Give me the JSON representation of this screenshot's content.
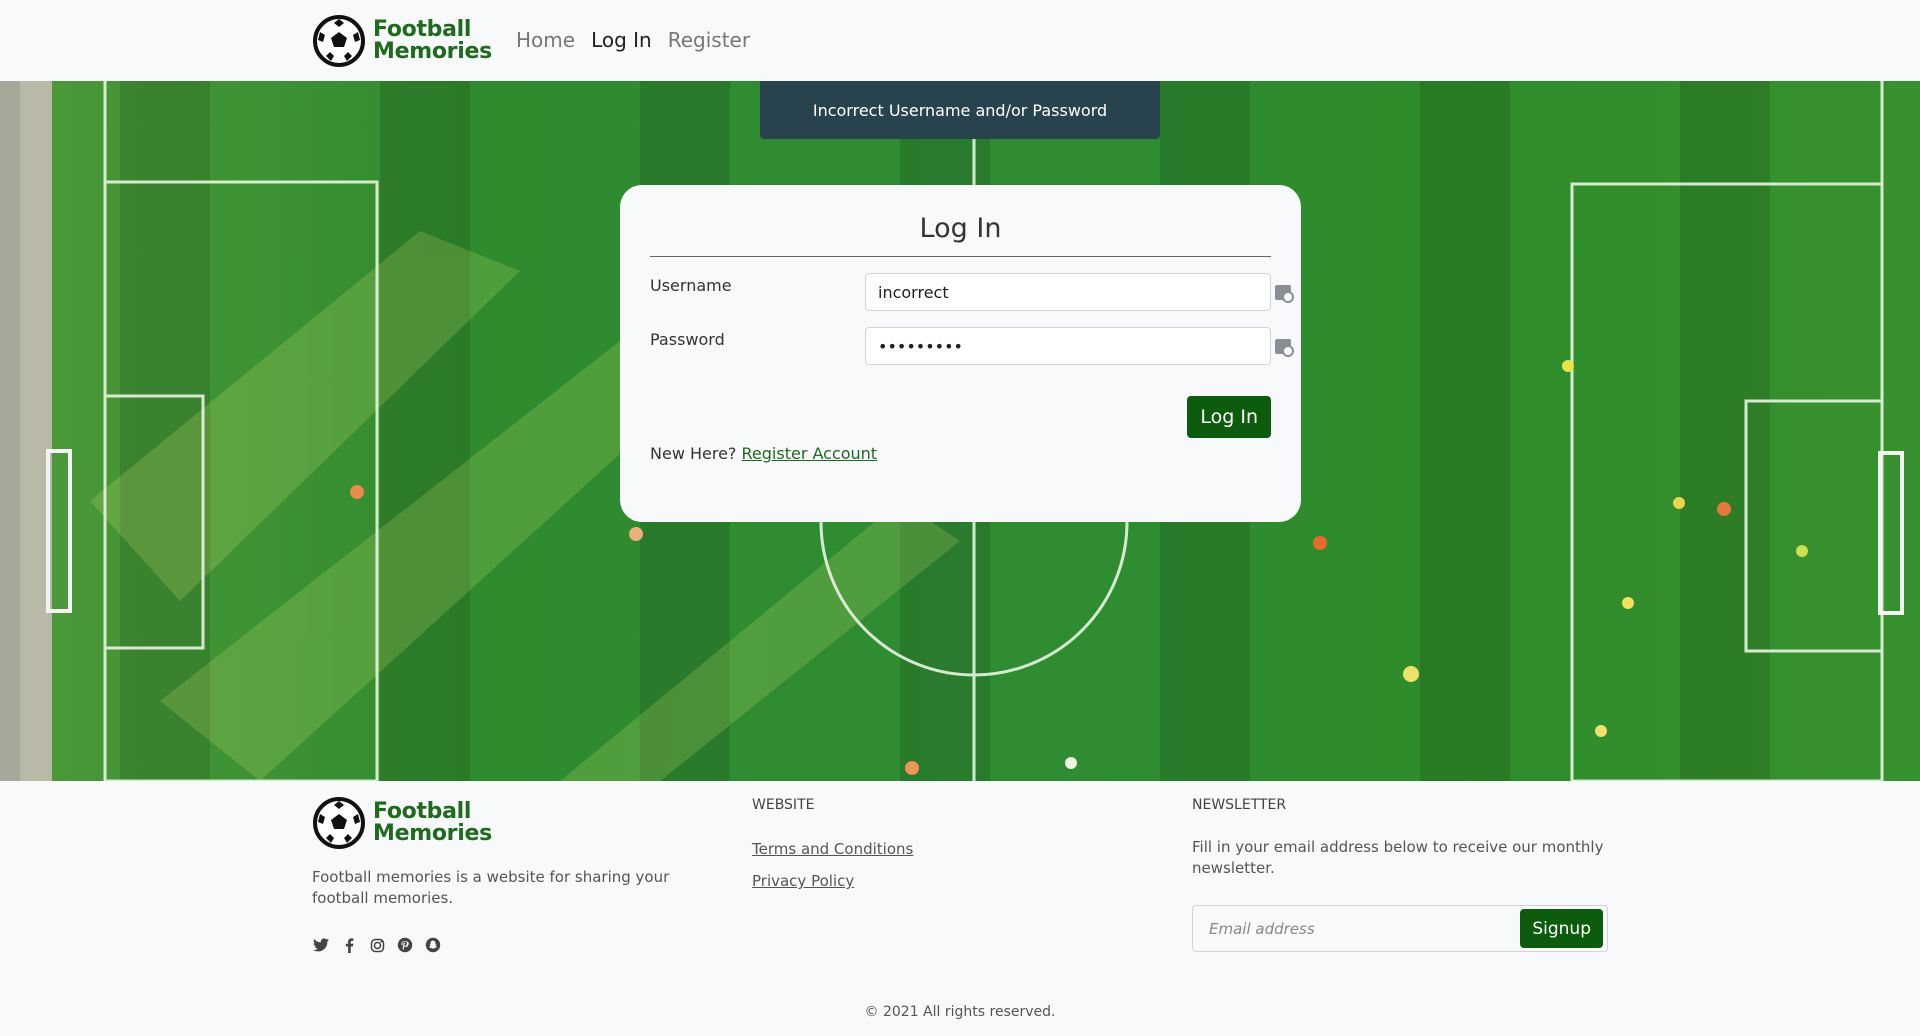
{
  "navbar": {
    "brand_line1": "Football",
    "brand_line2": "Memories",
    "links": [
      {
        "label": "Home",
        "active": false
      },
      {
        "label": "Log In",
        "active": true
      },
      {
        "label": "Register",
        "active": false
      }
    ]
  },
  "alert": {
    "message": "Incorrect Username and/or Password"
  },
  "login": {
    "title": "Log In",
    "username_label": "Username",
    "username_value": "incorrect",
    "password_label": "Password",
    "password_value": "•••••••••",
    "submit_label": "Log In",
    "new_here": "New Here?",
    "register_link": "Register Account"
  },
  "footer": {
    "brand_line1": "Football",
    "brand_line2": "Memories",
    "description": "Football memories is a website for sharing your football memories.",
    "socials": [
      "twitter-icon",
      "facebook-icon",
      "instagram-icon",
      "pinterest-icon",
      "snapchat-icon"
    ],
    "website_title": "WEBSITE",
    "links": [
      "Terms and Conditions",
      "Privacy Policy"
    ],
    "newsletter_title": "NEWSLETTER",
    "newsletter_text": "Fill in your email address below to receive our monthly newsletter.",
    "email_placeholder": "Email address",
    "signup_label": "Signup",
    "copyright": "© 2021 All rights reserved."
  },
  "colors": {
    "brand_green": "#1e6b1e",
    "button_green": "#0d5c0d",
    "alert_bg": "#29434e",
    "pitch_green": "#2f8a2a"
  }
}
